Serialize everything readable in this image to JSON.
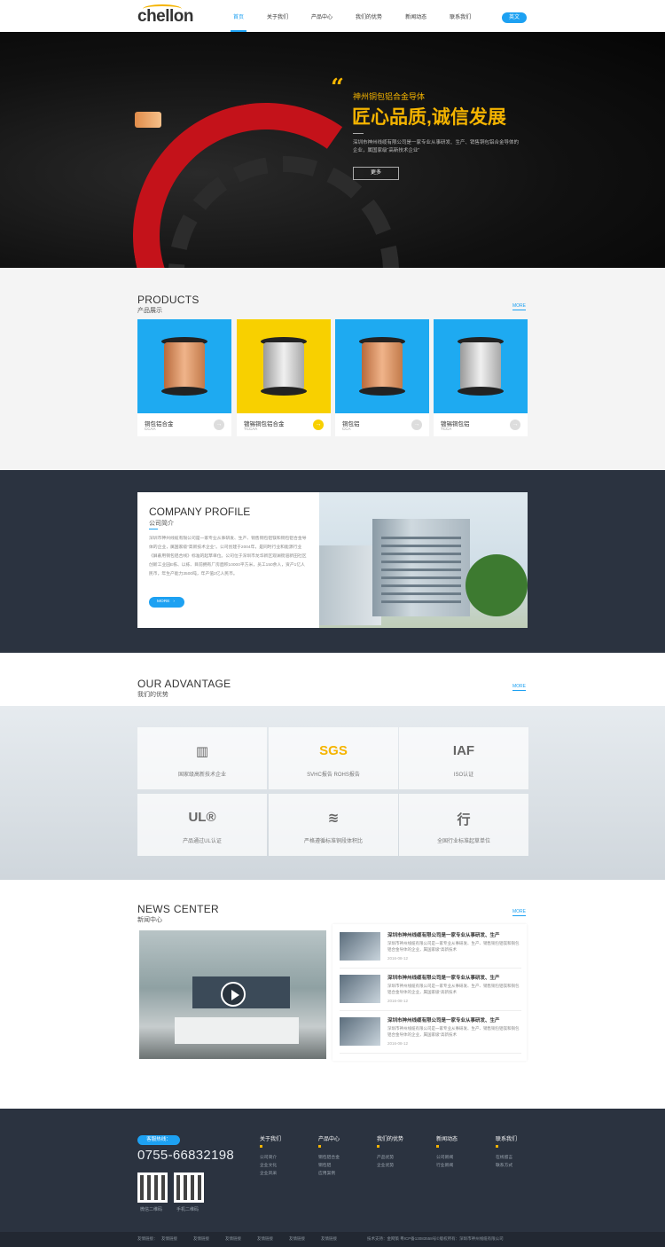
{
  "header": {
    "logo": "chellon",
    "nav": [
      "首页",
      "关于我们",
      "产品中心",
      "我们的优势",
      "新闻动态",
      "联系我们"
    ],
    "lang_btn": "英文"
  },
  "hero": {
    "quote": "“",
    "subtitle": "神州铜包铝合金导体",
    "title": "匠心品质,诚信发展",
    "desc": "深圳市神州线缆有限公司是一家专业从事研发、生产、销售铜包铝合金导体的企业，属国家级“高新技术企业”",
    "button": "更多"
  },
  "products": {
    "title": "PRODUCTS",
    "subtitle": "产品展示",
    "more": "MORE",
    "items": [
      {
        "name": "铜包铝合金",
        "code": "CCAA",
        "color": "#1eaaf1",
        "spool": "copper"
      },
      {
        "name": "镀锡铜包铝合金",
        "code": "TCCAA",
        "color": "#f8d000",
        "spool": "silver"
      },
      {
        "name": "铜包铝",
        "code": "CCA",
        "color": "#1eaaf1",
        "spool": "copper"
      },
      {
        "name": "镀锡铜包铝",
        "code": "TCCA",
        "color": "#1eaaf1",
        "spool": "silver"
      }
    ]
  },
  "company": {
    "title": "COMPANY PROFILE",
    "subtitle": "公司简介",
    "desc": "深圳市神州线缆有限公司是一家专业从事研发、生产、销售铜包铝镁和铜包铝合金导体的企业，属国家级“高新技术企业”。公司创建于2004年，是同时行业和能源行业《屏蔽用铜包铝合线》标准的起草单位。公司位于深圳市龙华新区观澜街道新田社区创新工业园E栋、以栋、目前拥有厂房面积10000平方米，员工150余人，资产1亿人民币，年生产能力3500吨，年产值2亿人民币。",
    "button": "MORE",
    "btn_icon": "›"
  },
  "advantage": {
    "title": "OUR ADVANTAGE",
    "subtitle": "我们的优势",
    "more": "MORE",
    "items": [
      {
        "icon": "building-icon",
        "glyph": "▥",
        "label": "国家级高新技术企业"
      },
      {
        "icon": "sgs-icon",
        "glyph": "SGS",
        "label": "SVHC报告 ROHS报告"
      },
      {
        "icon": "iaf-icon",
        "glyph": "IAF",
        "label": "ISO认证"
      },
      {
        "icon": "ul-icon",
        "glyph": "UL®",
        "label": "产品通过UL认证"
      },
      {
        "icon": "layers-icon",
        "glyph": "≋",
        "label": "严格遵循标准铜段体积比"
      },
      {
        "icon": "hang-icon",
        "glyph": "行",
        "label": "全国行业标准起草单位"
      }
    ]
  },
  "news": {
    "title": "NEWS CENTER",
    "subtitle": "新闻中心",
    "more": "MORE",
    "items": [
      {
        "title": "深圳市神州线缆有限公司是一家专业从事研发、生产",
        "desc": "深圳市神州线缆有限公司是一家专业从事研发、生产、销售铜包铝镁和铜包铝合金导体的企业，属国家级“高新技术",
        "date": "2016-08-12"
      },
      {
        "title": "深圳市神州线缆有限公司是一家专业从事研发、生产",
        "desc": "深圳市神州线缆有限公司是一家专业从事研发、生产、销售铜包铝镁和铜包铝合金导体的企业，属国家级“高新技术",
        "date": "2016-08-12"
      },
      {
        "title": "深圳市神州线缆有限公司是一家专业从事研发、生产",
        "desc": "深圳市神州线缆有限公司是一家专业从事研发、生产、销售铜包铝镁和铜包铝合金导体的企业，属国家级“高新技术",
        "date": "2016-08-12"
      }
    ]
  },
  "footer": {
    "hotline": "客服热线：",
    "phone": "0755-66832198",
    "qr": [
      "微信二维码",
      "手机二维码"
    ],
    "cols": [
      {
        "title": "关于我们",
        "items": [
          "公司简介",
          "企业文化",
          "企业风采"
        ]
      },
      {
        "title": "产品中心",
        "items": [
          "铜包铝合金",
          "铜包铝",
          "应用案例"
        ]
      },
      {
        "title": "我们的优势",
        "items": [
          "产品优势",
          "企业优势"
        ]
      },
      {
        "title": "新闻动态",
        "items": [
          "公司新闻",
          "行业新闻"
        ]
      },
      {
        "title": "联系我们",
        "items": [
          "在线留言",
          "联系方式"
        ]
      }
    ],
    "links": [
      "友情链接：",
      "友情链接",
      "友情链接",
      "友情链接",
      "友情链接",
      "友情链接",
      "友情链接"
    ],
    "copyright": "技术支持：金网策  粤ICP备13083558号©版权所有：深圳市神州线缆有限公司"
  }
}
